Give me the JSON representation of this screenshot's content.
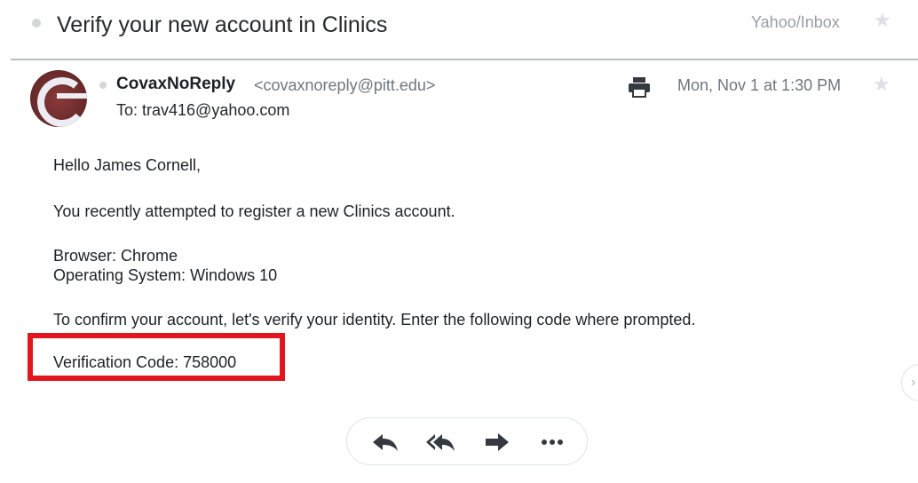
{
  "header": {
    "subject": "Verify your new account in Clinics",
    "folder": "Yahoo/Inbox"
  },
  "message": {
    "sender_name": "CovaxNoReply",
    "sender_email": "<covaxnoreply@pitt.edu>",
    "to": "To: trav416@yahoo.com",
    "date": "Mon, Nov 1 at 1:30 PM"
  },
  "body": {
    "greeting": "Hello James Cornell,",
    "line1": "You recently attempted to register a new Clinics account.",
    "browser": "Browser: Chrome",
    "os": "Operating System: Windows 10",
    "line2": "To confirm your account, let's verify your identity. Enter the following code where prompted.",
    "code": "Verification Code: 758000"
  },
  "colors": {
    "highlight": "#e1161f",
    "icon_gray": "#343a40",
    "muted": "#6e7780"
  },
  "icons": [
    "dot-icon",
    "star-icon",
    "avatar",
    "print-icon",
    "reply-icon",
    "reply-all-icon",
    "forward-icon",
    "more-icon",
    "chevron-right-icon"
  ]
}
